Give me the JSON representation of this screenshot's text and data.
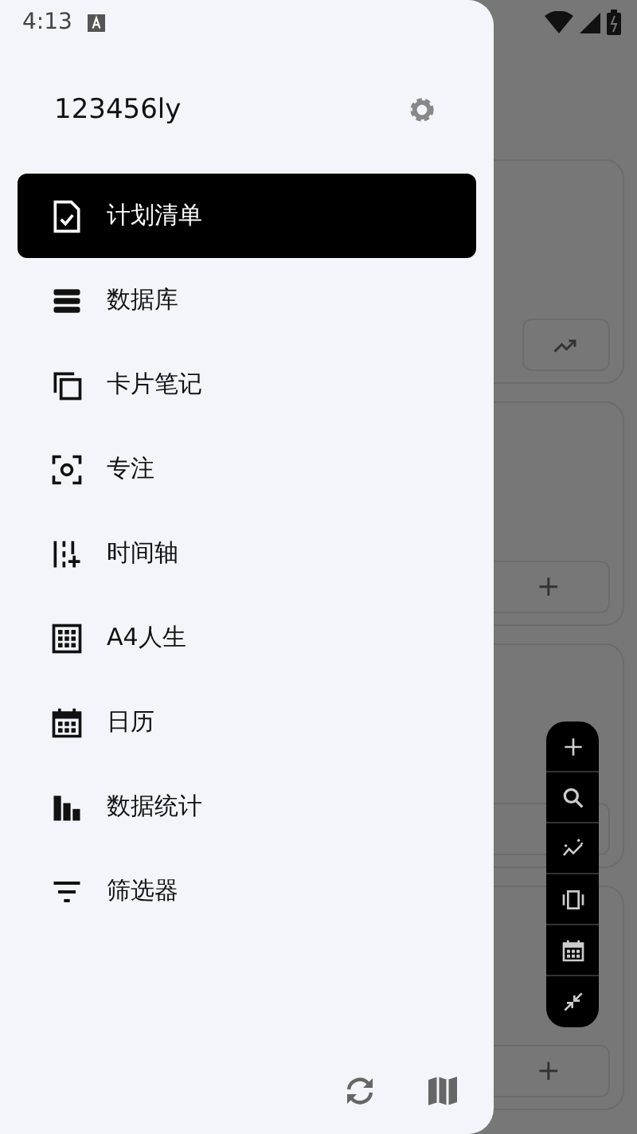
{
  "status_bar": {
    "time": "4:13"
  },
  "drawer": {
    "username": "123456ly",
    "items": [
      {
        "label": "计划清单",
        "selected": true
      },
      {
        "label": "数据库",
        "selected": false
      },
      {
        "label": "卡片笔记",
        "selected": false
      },
      {
        "label": "专注",
        "selected": false
      },
      {
        "label": "时间轴",
        "selected": false
      },
      {
        "label": "A4人生",
        "selected": false
      },
      {
        "label": "日历",
        "selected": false
      },
      {
        "label": "数据统计",
        "selected": false
      },
      {
        "label": "筛选器",
        "selected": false
      }
    ]
  },
  "background": {
    "cards": [
      {
        "button": {
          "kind": "trend"
        }
      },
      {
        "button": {
          "kind": "text",
          "label": "+"
        }
      },
      {
        "button": {
          "kind": "blank"
        }
      },
      {
        "button": {
          "kind": "text",
          "label": "+"
        }
      }
    ]
  }
}
